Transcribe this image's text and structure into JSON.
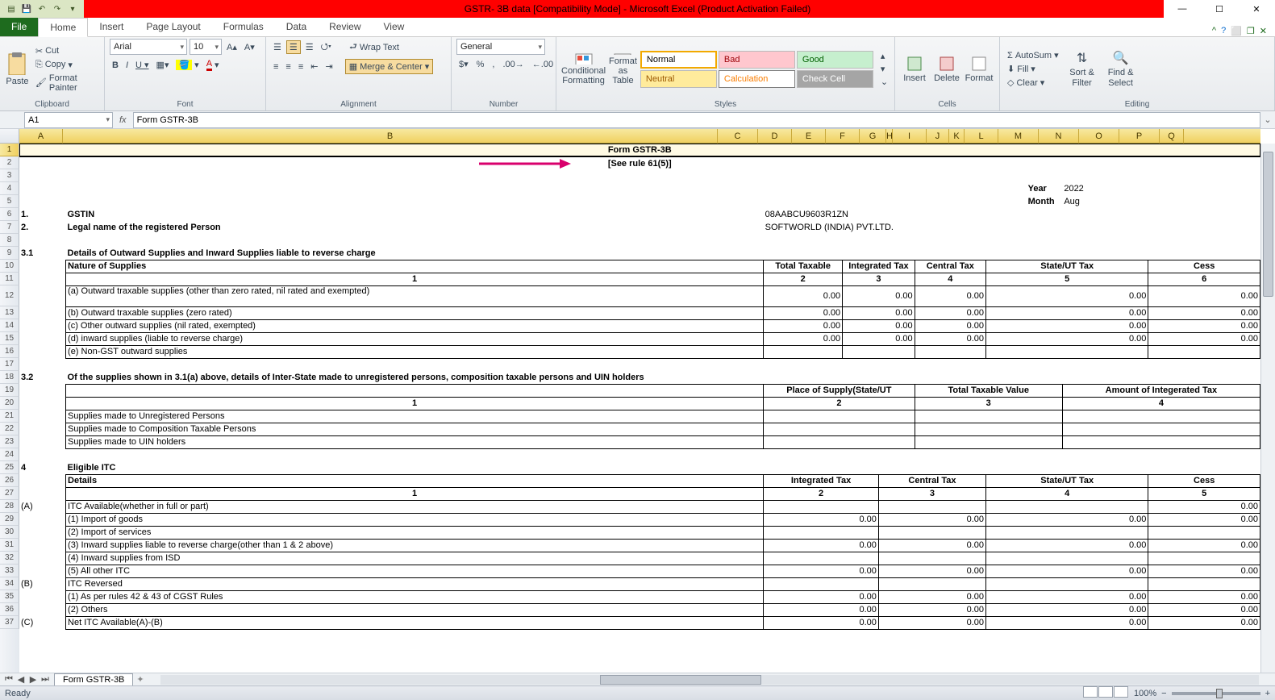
{
  "titlebar": {
    "title": "GSTR- 3B data  [Compatibility Mode]  -  Microsoft Excel (Product Activation Failed)"
  },
  "tabs": {
    "file": "File",
    "items": [
      "Home",
      "Insert",
      "Page Layout",
      "Formulas",
      "Data",
      "Review",
      "View"
    ],
    "active": "Home"
  },
  "ribbon": {
    "clipboard": {
      "paste": "Paste",
      "cut": "Cut",
      "copy": "Copy",
      "format_painter": "Format Painter",
      "label": "Clipboard"
    },
    "font": {
      "name": "Arial",
      "size": "10",
      "label": "Font"
    },
    "alignment": {
      "wrap": "Wrap Text",
      "merge": "Merge & Center",
      "label": "Alignment"
    },
    "number": {
      "format": "General",
      "label": "Number"
    },
    "tables": {
      "cond": "Conditional Formatting",
      "fmt_table": "Format as Table"
    },
    "styles": {
      "normal": "Normal",
      "bad": "Bad",
      "good": "Good",
      "neutral": "Neutral",
      "calc": "Calculation",
      "check": "Check Cell",
      "label": "Styles"
    },
    "cells": {
      "insert": "Insert",
      "delete": "Delete",
      "format": "Format",
      "label": "Cells"
    },
    "editing": {
      "autosum": "AutoSum",
      "fill": "Fill",
      "clear": "Clear",
      "sort": "Sort & Filter",
      "find": "Find & Select",
      "label": "Editing"
    }
  },
  "namebox": "A1",
  "formula": "Form GSTR-3B",
  "columns": [
    "A",
    "B",
    "C",
    "D",
    "E",
    "F",
    "G",
    "H",
    "I",
    "J",
    "K",
    "L",
    "M",
    "N",
    "O",
    "P",
    "Q"
  ],
  "rows": {
    "r1_title": "Form GSTR-3B",
    "r2_sub": "[See rule 61(5)]",
    "year_label": "Year",
    "year_val": "2022",
    "month_label": "Month",
    "month_val": "Aug",
    "r6_no": "1.",
    "r6_label": "GSTIN",
    "r6_val": "08AABCU9603R1ZN",
    "r7_no": "2.",
    "r7_label": "Legal name of the registered Person",
    "r7_val": "SOFTWORLD (INDIA) PVT.LTD.",
    "r9_no": "3.1",
    "r9_label": "Details of Outward Supplies and Inward Supplies liable to reverse charge",
    "r10_nature": "Nature of Supplies",
    "r10_h1": "Total Taxable",
    "r10_h2": "Integrated Tax",
    "r10_h3": "Central Tax",
    "r10_h4": "State/UT Tax",
    "r10_h5": "Cess",
    "r11_1": "1",
    "r11_2": "2",
    "r11_3": "3",
    "r11_4": "4",
    "r11_5": "5",
    "r11_6": "6",
    "r12": "(a) Outward traxable supplies (other than zero rated, nil rated and exempted)",
    "r13": "(b) Outward traxable supplies (zero rated)",
    "r14": "(c) Other outward supplies (nil rated, exempted)",
    "r15": "(d) inward supplies (liable to reverse charge)",
    "r16": "(e) Non-GST outward supplies",
    "zero": "0.00",
    "r18_no": "3.2",
    "r18_label": "Of the supplies shown in 3.1(a) above, details of Inter-State made to unregistered persons, composition taxable persons and UIN holders",
    "r19_h1": "Place of Supply(State/UT",
    "r19_h2": "Total Taxable Value",
    "r19_h3": "Amount of Integerated Tax",
    "r20_1": "1",
    "r20_2": "2",
    "r20_3": "3",
    "r20_4": "4",
    "r21": "Supplies made to Unregistered Persons",
    "r22": "Supplies made to Composition Taxable Persons",
    "r23": "Supplies made to UIN holders",
    "r25_no": "4",
    "r25_label": "Eligible ITC",
    "r26_details": "Details",
    "r26_h1": "Integrated Tax",
    "r26_h2": "Central Tax",
    "r26_h3": "State/UT Tax",
    "r26_h4": "Cess",
    "r27_1": "1",
    "r27_2": "2",
    "r27_3": "3",
    "r27_4": "4",
    "r27_5": "5",
    "r28_A": "(A)",
    "r28": "ITC Available(whether in full or part)",
    "r29": "(1) Import of goods",
    "r30": "(2) Import of services",
    "r31": "(3) Inward supplies liable to reverse charge(other than 1 & 2 above)",
    "r32": "(4) Inward supplies from ISD",
    "r33": "(5) All other ITC",
    "r34_B": "(B)",
    "r34": "ITC Reversed",
    "r35": "(1) As per rules 42 & 43 of CGST Rules",
    "r36": "(2) Others",
    "r37_C": "(C)",
    "r37": "Net ITC Available(A)-(B)"
  },
  "sheet_tab": "Form GSTR-3B",
  "status": {
    "ready": "Ready",
    "zoom": "100%"
  }
}
